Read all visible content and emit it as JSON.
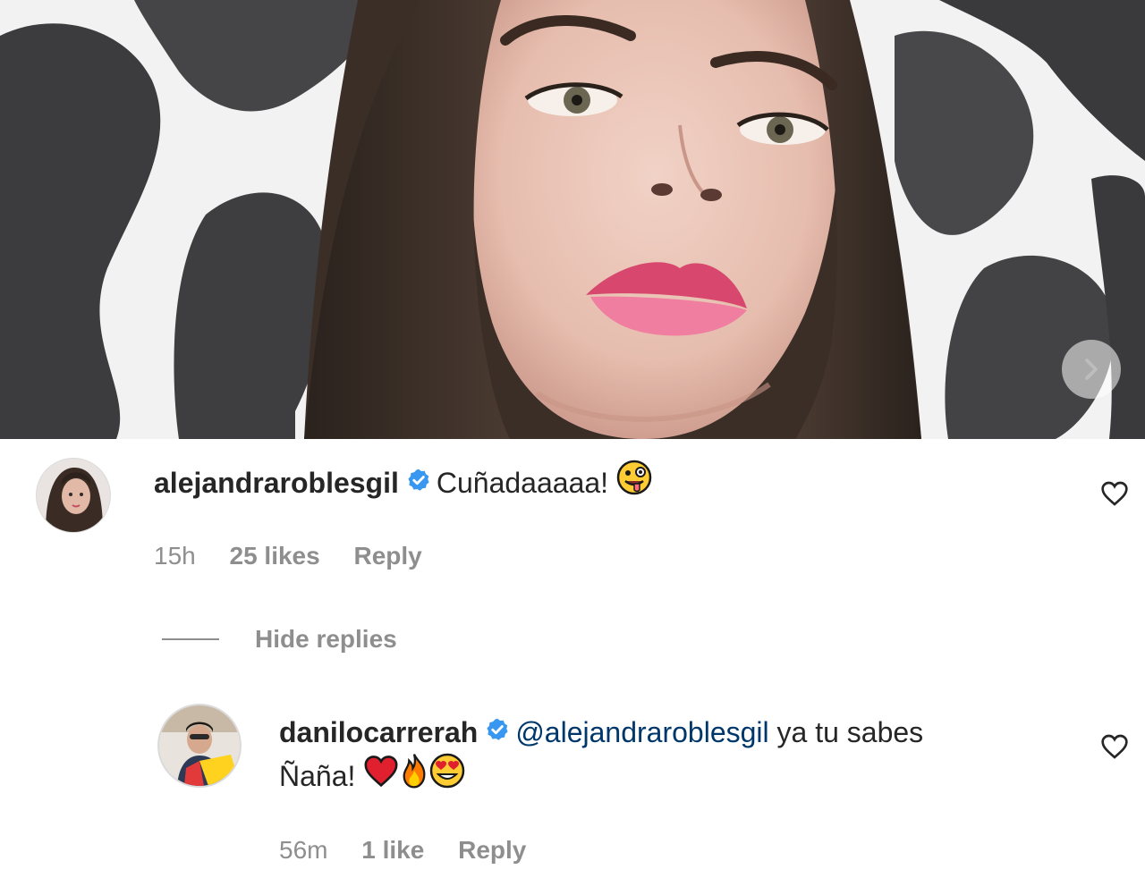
{
  "photo": {
    "next_icon": "chevron-right-icon"
  },
  "comment": {
    "username": "alejandraroblesgil",
    "text": "Cuñadaaaaa!",
    "emoji": "zany-face",
    "time": "15h",
    "likes": "25 likes",
    "reply_label": "Reply"
  },
  "replies_toggle": {
    "label": "Hide replies"
  },
  "reply": {
    "username": "danilocarrerah",
    "mention": "@alejandraroblesgil",
    "text_line1": "ya tu sabes",
    "text_line2": "Ñaña!",
    "emojis": [
      "red-heart",
      "fire",
      "heart-eyes"
    ],
    "time": "56m",
    "likes": "1 like",
    "reply_label": "Reply"
  },
  "colors": {
    "verified": "#3897f0",
    "mention": "#00376b",
    "meta": "#8e8e8e"
  }
}
